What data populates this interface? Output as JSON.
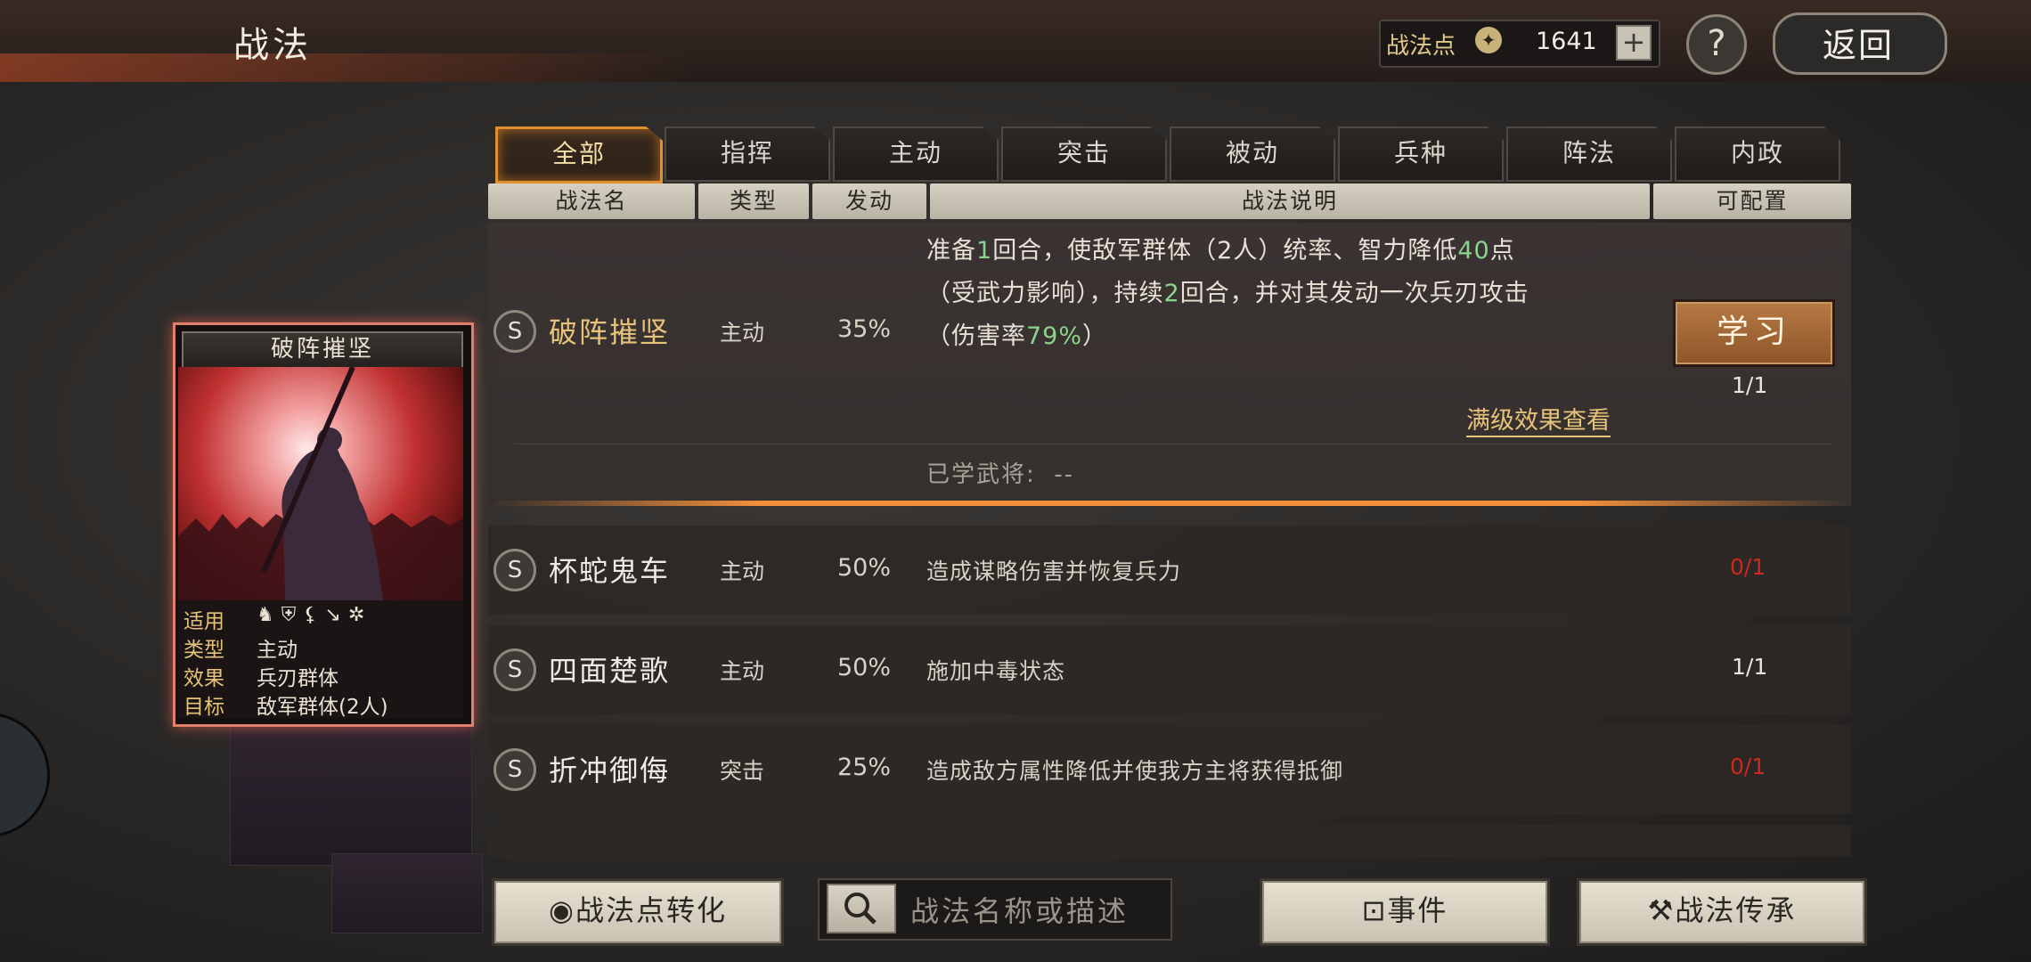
{
  "header": {
    "title": "战法",
    "points_label": "战法点",
    "points_value": "1641",
    "plus": "+",
    "help": "?",
    "back_label": "返回"
  },
  "tabs": [
    "全部",
    "指挥",
    "主动",
    "突击",
    "被动",
    "兵种",
    "阵法",
    "内政"
  ],
  "columns": [
    "战法名",
    "类型",
    "发动",
    "战法说明",
    "可配置"
  ],
  "selected": {
    "grade": "S",
    "name": "破阵摧坚",
    "type": "主动",
    "rate": "35%",
    "desc_line1_a": "准备",
    "desc_line1_n1": "1",
    "desc_line1_b": "回合，使敌军群体（2人）统率、智力降低",
    "desc_line1_n2": "40",
    "desc_line1_c": "点",
    "desc_line2_a": "（受武力影响），持续",
    "desc_line2_n": "2",
    "desc_line2_b": "回合，并对其发动一次兵刃攻击",
    "desc_line3_a": "（伤害率",
    "desc_line3_n": "79%",
    "desc_line3_b": "）",
    "learn_label": "学习",
    "count": "1/1",
    "max_effect_link": "满级效果查看",
    "learned_label": "已学武将:",
    "learned_value": "--"
  },
  "rows": [
    {
      "grade": "S",
      "name": "杯蛇鬼车",
      "type": "主动",
      "rate": "50%",
      "desc": "造成谋略伤害并恢复兵力",
      "count": "0/1"
    },
    {
      "grade": "S",
      "name": "四面楚歌",
      "type": "主动",
      "rate": "50%",
      "desc": "施加中毒状态",
      "count": "1/1"
    },
    {
      "grade": "S",
      "name": "折冲御侮",
      "type": "突击",
      "rate": "25%",
      "desc": "造成敌方属性降低并使我方主将获得抵御",
      "count": "0/1"
    }
  ],
  "card": {
    "title": "破阵摧坚",
    "applies_label": "适用",
    "type_label": "类型",
    "type_value": "主动",
    "effect_label": "效果",
    "effect_value": "兵刃群体",
    "target_label": "目标",
    "target_value": "敌军群体(2人)",
    "unit_icons": [
      "cavalry-icon",
      "shield-icon",
      "bow-icon",
      "spear-icon",
      "siege-icon"
    ]
  },
  "bottom": {
    "convert_label": "战法点转化",
    "search_placeholder": "战法名称或描述",
    "event_label": "事件",
    "inherit_label": "战法传承"
  },
  "colors": {
    "accent": "#e0902e",
    "highlight_green": "#8cd48c",
    "red_count": "#d0261e",
    "gold_text": "#e6c27a"
  }
}
